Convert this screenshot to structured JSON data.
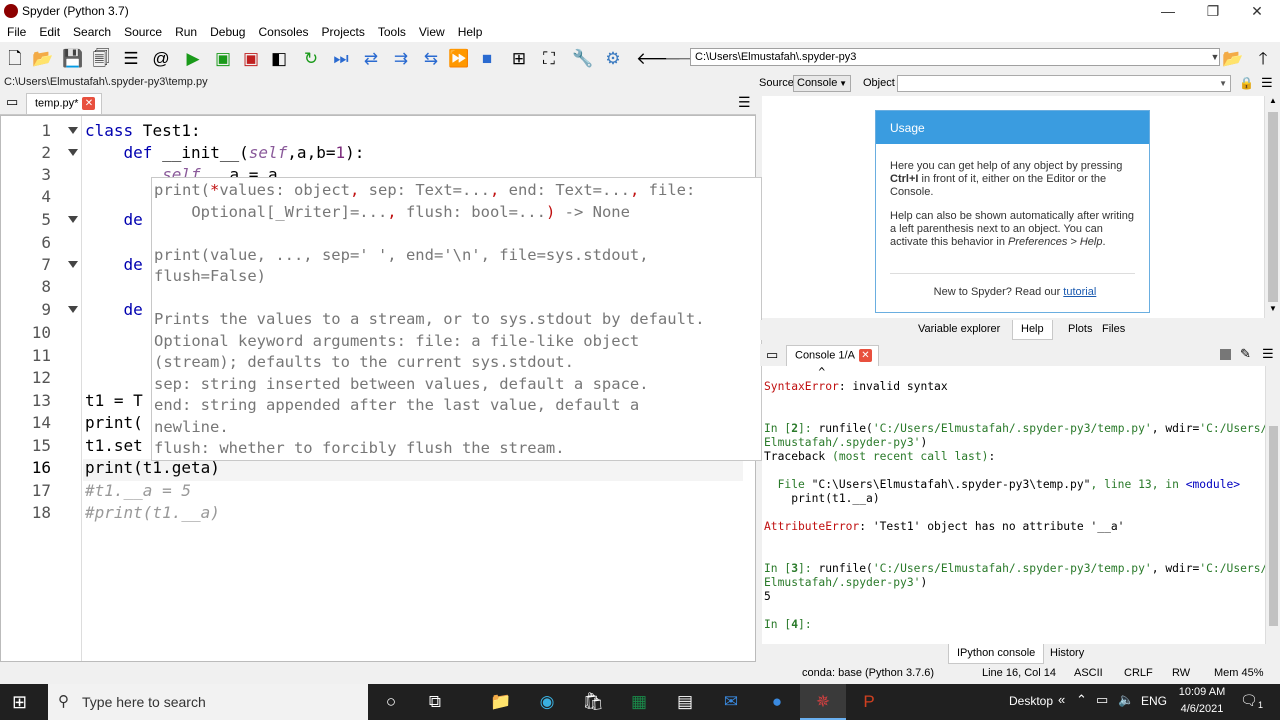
{
  "window": {
    "title": "Spyder (Python 3.7)",
    "controls": [
      "—",
      "❐",
      "✕"
    ]
  },
  "menu": [
    "File",
    "Edit",
    "Search",
    "Source",
    "Run",
    "Debug",
    "Consoles",
    "Projects",
    "Tools",
    "View",
    "Help"
  ],
  "toolbar": {
    "path": "C:\\Users\\Elmustafah\\.spyder-py3"
  },
  "editor": {
    "filepath": "C:\\Users\\Elmustafah\\.spyder-py3\\temp.py",
    "tab": "temp.py*",
    "line_numbers": [
      "1",
      "2",
      "3",
      "4",
      "5",
      "6",
      "7",
      "8",
      "9",
      "10",
      "11",
      "12",
      "13",
      "14",
      "15",
      "16",
      "17",
      "18"
    ],
    "lines": {
      "l1_kw": "class",
      "l1_rest": " Test1:",
      "l2_kw": "def",
      "l2_a": " __init__(",
      "l2_self": "self",
      "l2_b": ",a,b=",
      "l2_num": "1",
      "l2_c": "):",
      "l3_self": "self",
      "l3_rest": ".__a = a",
      "l5": "de",
      "l7": "de",
      "l9": "de",
      "l13": "t1 = T",
      "l14": "print(",
      "l15": "t1.set",
      "l16": "print(t1.geta)",
      "l17": "#t1.__a = 5",
      "l18": "#print(t1.__a)"
    },
    "calltip": {
      "sig1_a": "print(",
      "sig1_b": "*",
      "sig1_c": "values: object",
      "sig1_d": ", ",
      "sig1_e": "sep: Text=...",
      "sig1_f": ", ",
      "sig1_g": "end: Text=...",
      "sig1_h": ", ",
      "sig1_i": "file:",
      "sig2_a": "    Optional[_Writer]=...",
      "sig2_b": ", ",
      "sig2_c": "flush: bool=...",
      "sig2_d": ")",
      "sig2_e": " -> None",
      "sig3": "print(value, ..., sep=' ', end='\\n', file=sys.stdout,",
      "sig4": "flush=False)",
      "doc": "Prints the values to a stream, or to sys.stdout by default.\nOptional keyword arguments: file: a file-like object\n(stream); defaults to the current sys.stdout.\nsep: string inserted between values, default a space.\nend: string appended after the last value, default a\nnewline.\nflush: whether to forcibly flush the stream."
    }
  },
  "help": {
    "source_label": "Source",
    "source_value": "Console",
    "object_label": "Object",
    "usage_title": "Usage",
    "p1_a": "Here you can get help of any object by pressing ",
    "p1_b": "Ctrl+I",
    "p1_c": " in front of it, either on the Editor or the Console.",
    "p2_a": "Help can also be shown automatically after writing a left parenthesis next to an object. You can activate this behavior in ",
    "p2_b": "Preferences > Help",
    "p2_c": ".",
    "p3_a": "New to Spyder? Read our ",
    "p3_b": "tutorial",
    "tabs": [
      "Variable explorer",
      "Help",
      "Plots",
      "Files"
    ]
  },
  "console": {
    "tab": "Console 1/A",
    "line_caret": "        ^",
    "se_kw": "SyntaxError",
    "se_msg": ": invalid syntax",
    "in2_prompt": "In [",
    "in2_num": "2",
    "in2_close": "]: ",
    "in2_cmd_a": "runfile(",
    "in2_str1": "'C:/Users/Elmustafah/.spyder-py3/temp.py'",
    "in2_mid": ", wdir=",
    "in2_str2a": "'C:/Users/",
    "in2_str2b": "Elmustafah/.spyder-py3'",
    "in2_end": ")",
    "tb_a": "Traceback ",
    "tb_b": "(most recent call last)",
    "tb_c": ":",
    "file_a": "  File ",
    "file_b": "\"C:\\Users\\Elmustafah\\.spyder-py3\\temp.py\"",
    "file_c": ", line ",
    "file_d": "13",
    "file_e": ", in ",
    "file_f": "<module>",
    "file_code": "    print(t1.__a)",
    "ae_kw": "AttributeError",
    "ae_msg": ": 'Test1' object has no attribute '__a'",
    "in3_num": "3",
    "out3": "5",
    "in4_num": "4",
    "tabs": [
      "IPython console",
      "History"
    ]
  },
  "status": {
    "conda": "conda: base (Python 3.7.6)",
    "pos": "Line 16, Col 14",
    "enc": "ASCII",
    "eol": "CRLF",
    "rw": "RW",
    "mem": "Mem 45%"
  },
  "taskbar": {
    "search_placeholder": "Type here to search",
    "desktop": "Desktop",
    "lang": "ENG",
    "time": "10:09 AM",
    "date": "4/6/2021",
    "notif": "1"
  }
}
